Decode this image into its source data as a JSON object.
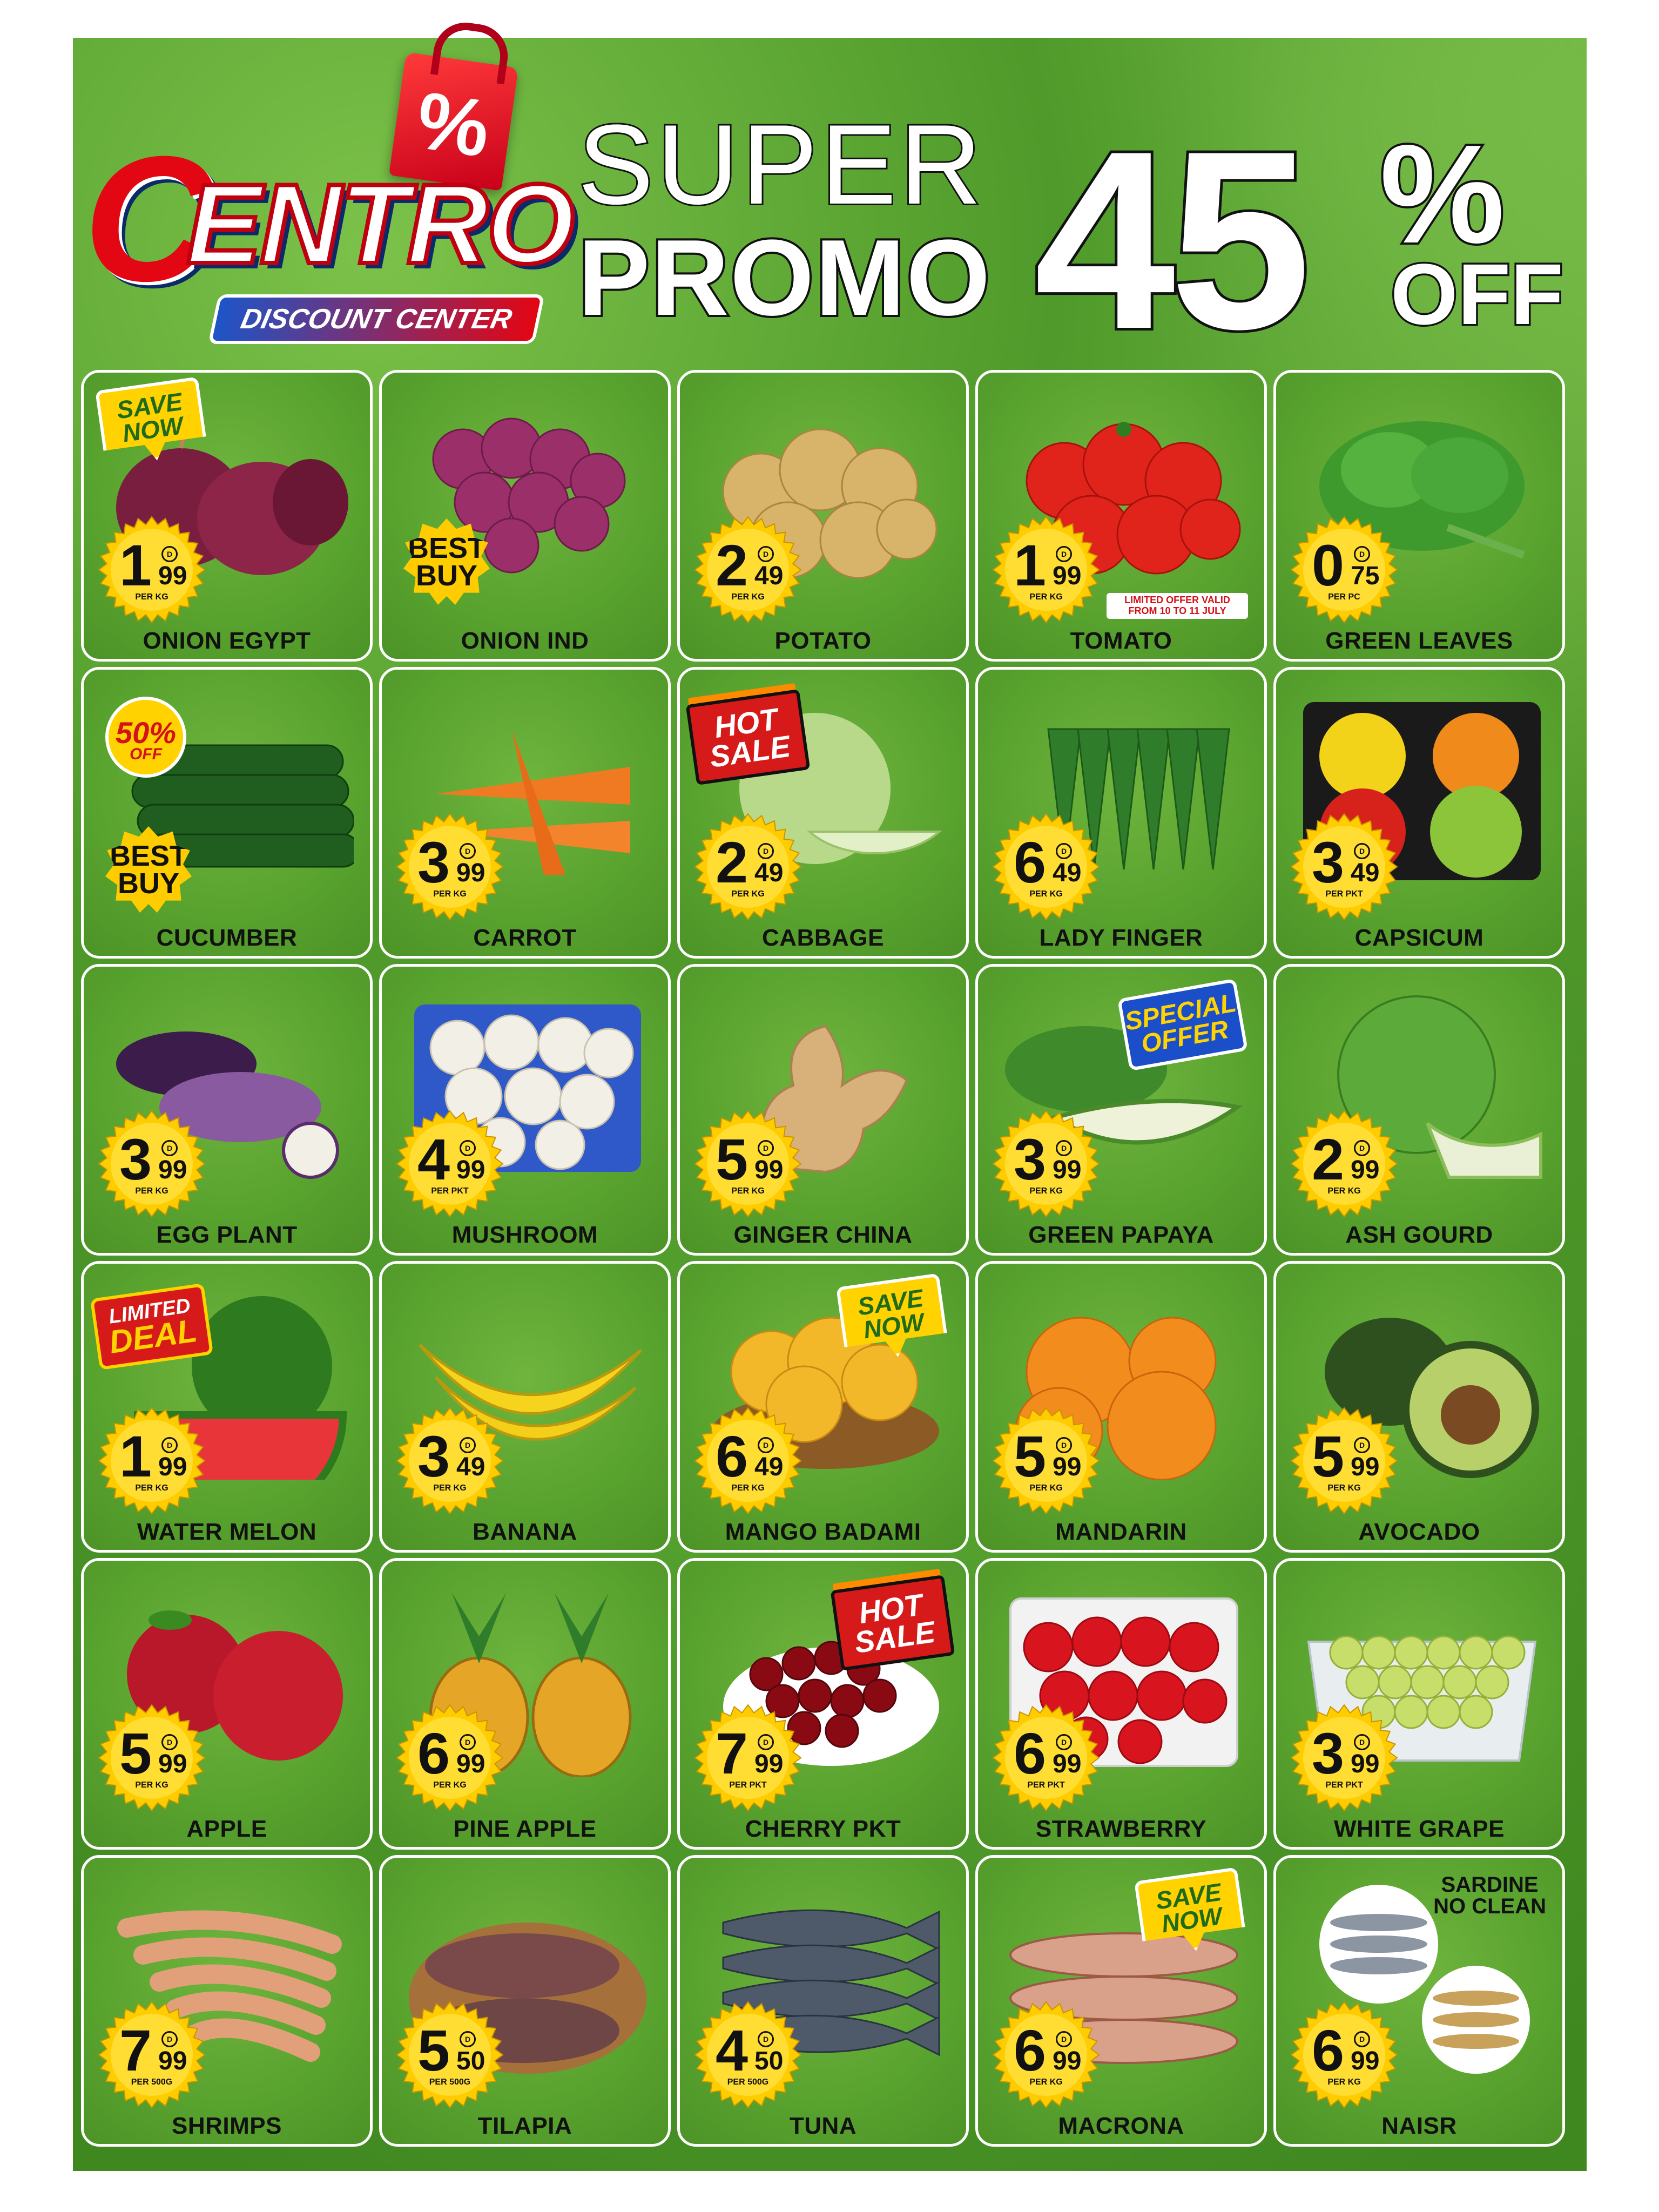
{
  "brand": {
    "logo_percent": "%",
    "logo_letter": "C",
    "logo_name": "ENTRO",
    "tagline": "DISCOUNT CENTER"
  },
  "headline": {
    "line1": "SUPER",
    "line2": "PROMO",
    "discount_number": "45",
    "discount_percent": "%",
    "discount_off": "OFF"
  },
  "products": [
    {
      "name": "ONION EGYPT",
      "price_int": "1",
      "price_dec": "99",
      "unit": "PER KG",
      "tag": "save",
      "kind": "onion-red"
    },
    {
      "name": "ONION IND",
      "price_int": "",
      "price_dec": "",
      "unit": "",
      "tag": "best",
      "kind": "onion-small"
    },
    {
      "name": "POTATO",
      "price_int": "2",
      "price_dec": "49",
      "unit": "PER KG",
      "tag": "",
      "kind": "potato"
    },
    {
      "name": "TOMATO",
      "price_int": "1",
      "price_dec": "99",
      "unit": "PER KG",
      "tag": "",
      "kind": "tomato",
      "note": "LIMITED OFFER VALID FROM 10 TO 11 JULY"
    },
    {
      "name": "GREEN LEAVES",
      "price_int": "0",
      "price_dec": "75",
      "unit": "PER PC",
      "tag": "",
      "kind": "leaves"
    },
    {
      "name": "CUCUMBER",
      "price_int": "",
      "price_dec": "",
      "unit": "",
      "tag": "best",
      "tag2": "fifty",
      "kind": "cucumber"
    },
    {
      "name": "CARROT",
      "price_int": "3",
      "price_dec": "99",
      "unit": "PER KG",
      "tag": "",
      "kind": "carrot"
    },
    {
      "name": "CABBAGE",
      "price_int": "2",
      "price_dec": "49",
      "unit": "PER KG",
      "tag": "hot",
      "kind": "cabbage"
    },
    {
      "name": "LADY FINGER",
      "price_int": "6",
      "price_dec": "49",
      "unit": "PER KG",
      "tag": "",
      "kind": "okra"
    },
    {
      "name": "CAPSICUM",
      "price_int": "3",
      "price_dec": "49",
      "unit": "PER PKT",
      "tag": "",
      "kind": "capsicum"
    },
    {
      "name": "EGG PLANT",
      "price_int": "3",
      "price_dec": "99",
      "unit": "PER KG",
      "tag": "",
      "kind": "eggplant"
    },
    {
      "name": "MUSHROOM",
      "price_int": "4",
      "price_dec": "99",
      "unit": "PER PKT",
      "tag": "",
      "kind": "mushroom"
    },
    {
      "name": "GINGER CHINA",
      "price_int": "5",
      "price_dec": "99",
      "unit": "PER KG",
      "tag": "",
      "kind": "ginger"
    },
    {
      "name": "GREEN PAPAYA",
      "price_int": "3",
      "price_dec": "99",
      "unit": "PER KG",
      "tag": "special",
      "kind": "papaya"
    },
    {
      "name": "ASH GOURD",
      "price_int": "2",
      "price_dec": "99",
      "unit": "PER KG",
      "tag": "",
      "kind": "gourd"
    },
    {
      "name": "WATER MELON",
      "price_int": "1",
      "price_dec": "99",
      "unit": "PER KG",
      "tag": "limited",
      "kind": "watermelon"
    },
    {
      "name": "BANANA",
      "price_int": "3",
      "price_dec": "49",
      "unit": "PER KG",
      "tag": "",
      "kind": "banana"
    },
    {
      "name": "MANGO BADAMI",
      "price_int": "6",
      "price_dec": "49",
      "unit": "PER KG",
      "tag": "save-right",
      "kind": "mango"
    },
    {
      "name": "MANDARIN",
      "price_int": "5",
      "price_dec": "99",
      "unit": "PER KG",
      "tag": "",
      "kind": "mandarin"
    },
    {
      "name": "AVOCADO",
      "price_int": "5",
      "price_dec": "99",
      "unit": "PER KG",
      "tag": "",
      "kind": "avocado"
    },
    {
      "name": "APPLE",
      "price_int": "5",
      "price_dec": "99",
      "unit": "PER KG",
      "tag": "",
      "kind": "apple"
    },
    {
      "name": "PINE APPLE",
      "price_int": "6",
      "price_dec": "99",
      "unit": "PER KG",
      "tag": "",
      "kind": "pineapple"
    },
    {
      "name": "CHERRY PKT",
      "price_int": "7",
      "price_dec": "99",
      "unit": "PER PKT",
      "tag": "hot-right",
      "kind": "cherry"
    },
    {
      "name": "STRAWBERRY",
      "price_int": "6",
      "price_dec": "99",
      "unit": "PER PKT",
      "tag": "",
      "kind": "strawberry"
    },
    {
      "name": "WHITE GRAPE",
      "price_int": "3",
      "price_dec": "99",
      "unit": "PER PKT",
      "tag": "",
      "kind": "grape"
    },
    {
      "name": "SHRIMPS",
      "price_int": "7",
      "price_dec": "99",
      "unit": "PER 500G",
      "tag": "",
      "kind": "shrimp"
    },
    {
      "name": "TILAPIA",
      "price_int": "5",
      "price_dec": "50",
      "unit": "PER 500G",
      "tag": "",
      "kind": "tilapia"
    },
    {
      "name": "TUNA",
      "price_int": "4",
      "price_dec": "50",
      "unit": "PER 500G",
      "tag": "",
      "kind": "tuna"
    },
    {
      "name": "MACRONA",
      "price_int": "6",
      "price_dec": "99",
      "unit": "PER KG",
      "tag": "save-right",
      "kind": "macrona"
    },
    {
      "name": "NAISR",
      "price_int": "6",
      "price_dec": "99",
      "unit": "PER KG",
      "tag": "",
      "kind": "naisr",
      "corner": "SARDINE\nNO CLEAN"
    }
  ],
  "badges": {
    "save": "SAVE NOW",
    "best": "BEST BUY",
    "hot": "HOT SALE",
    "fifty_value": "50%",
    "fifty_off": "OFF",
    "special": "SPECIAL OFFER",
    "limited_top": "LIMITED",
    "limited_bottom": "DEAL",
    "currency": "D"
  },
  "colors": {
    "brand_red": "#e30613",
    "brand_blue": "#0a2a6a",
    "card_green": "#58a22e",
    "burst_yellow": "#ffcc00"
  }
}
